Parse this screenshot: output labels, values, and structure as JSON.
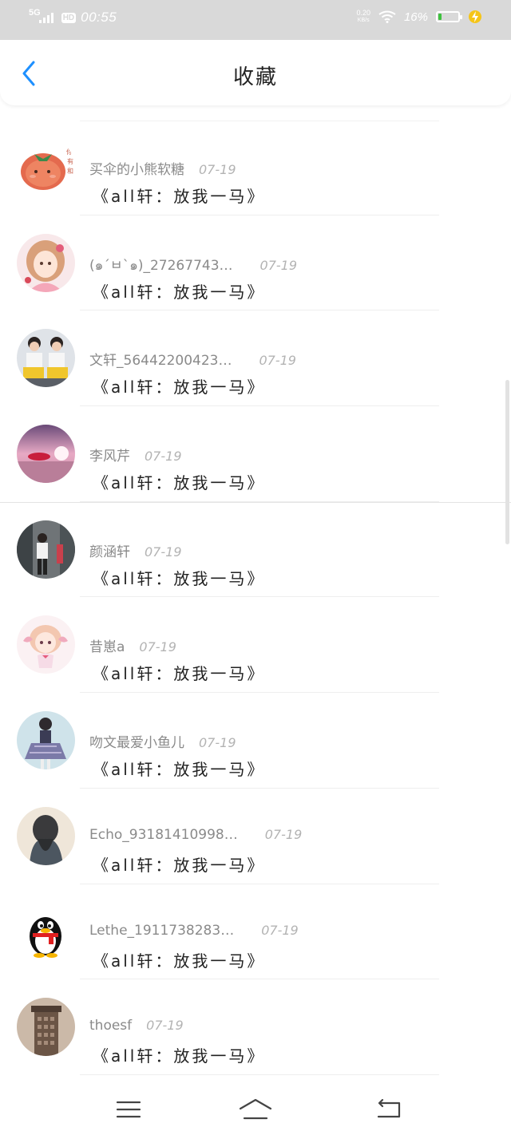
{
  "status_bar": {
    "network": "5G",
    "hd": "HD",
    "time": "00:55",
    "net_speed_value": "0.20",
    "net_speed_unit": "KB/s",
    "battery_percent": "16%",
    "battery_level": 0.16,
    "colors": {
      "bar": "#d9d9d9",
      "battery_fill": "#3ec13e",
      "charge": "#f5c518"
    }
  },
  "header": {
    "title": "收藏",
    "back_icon": "chevron-left-icon",
    "accent_color": "#1e90ff"
  },
  "favorites": [
    {
      "username": "买伞的小熊软糖",
      "date": "07-19",
      "title": "《all轩：放我一马》",
      "avatar": "tomato-avatar"
    },
    {
      "username": "(๑´ㅂ`๑)_27267743…",
      "date": "07-19",
      "title": "《all轩：放我一马》",
      "avatar": "anime-girl-avatar"
    },
    {
      "username": "文轩_56442200423…",
      "date": "07-19",
      "title": "《all轩：放我一马》",
      "avatar": "two-boys-avatar"
    },
    {
      "username": "李风芹",
      "date": "07-19",
      "title": "《all轩：放我一马》",
      "avatar": "pink-sky-avatar"
    },
    {
      "username": "颜涵轩",
      "date": "07-19",
      "title": "《all轩：放我一马》",
      "avatar": "boy-street-avatar"
    },
    {
      "username": "昔崽a",
      "date": "07-19",
      "title": "《all轩：放我一马》",
      "avatar": "chibi-girl-avatar"
    },
    {
      "username": "吻文最爱小鱼儿",
      "date": "07-19",
      "title": "《all轩：放我一马》",
      "avatar": "girl-skirt-avatar"
    },
    {
      "username": "Echo_93181410998…",
      "date": "07-19",
      "title": "《all轩：放我一马》",
      "avatar": "girl-back-avatar"
    },
    {
      "username": "Lethe_1911738283…",
      "date": "07-19",
      "title": "《all轩：放我一马》",
      "avatar": "qq-penguin-avatar"
    },
    {
      "username": "thoesf",
      "date": "07-19",
      "title": "《all轩：放我一马》",
      "avatar": "building-avatar"
    }
  ],
  "nav_bar": {
    "menu_icon": "menu-icon",
    "home_icon": "home-icon",
    "back_icon": "back-icon"
  }
}
